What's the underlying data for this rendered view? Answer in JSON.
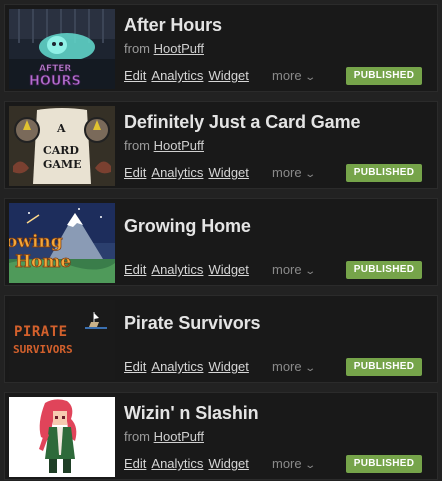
{
  "projects": [
    {
      "title": "After Hours",
      "from_prefix": "from ",
      "author": "HootPuff",
      "actions": [
        "Edit",
        "Analytics",
        "Widget"
      ],
      "more_label": "more",
      "status": "PUBLISHED",
      "thumb_text": [
        "AFTER",
        "HOURS"
      ]
    },
    {
      "title": "Definitely Just a Card Game",
      "from_prefix": "from ",
      "author": "HootPuff",
      "actions": [
        "Edit",
        "Analytics",
        "Widget"
      ],
      "more_label": "more",
      "status": "PUBLISHED",
      "thumb_text": [
        "A",
        "CARD",
        "GAME"
      ]
    },
    {
      "title": "Growing Home",
      "actions": [
        "Edit",
        "Analytics",
        "Widget"
      ],
      "more_label": "more",
      "status": "PUBLISHED",
      "thumb_text": [
        "owing",
        "Home"
      ]
    },
    {
      "title": "Pirate Survivors",
      "actions": [
        "Edit",
        "Analytics",
        "Widget"
      ],
      "more_label": "more",
      "status": "PUBLISHED",
      "thumb_text": [
        "PIRATE",
        "SURVIVORS"
      ]
    },
    {
      "title": "Wizin' n Slashin",
      "from_prefix": "from ",
      "author": "HootPuff",
      "actions": [
        "Edit",
        "Analytics",
        "Widget"
      ],
      "more_label": "more",
      "status": "PUBLISHED"
    }
  ],
  "colors": {
    "published_badge": "#76a44a",
    "row_background": "#191919",
    "page_background": "#222222"
  }
}
